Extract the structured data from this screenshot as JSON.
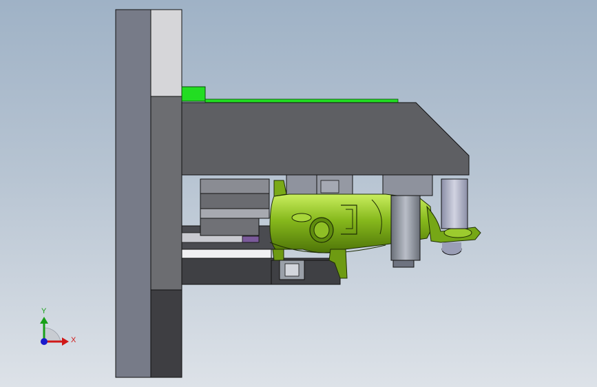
{
  "triad": {
    "y_label": "Y",
    "x_label": "X"
  },
  "colors": {
    "background_top": "#9fb2c6",
    "background_bottom": "#dde2e8",
    "plate_dark": "#5f6066",
    "plate_mid": "#75787e",
    "plate_light": "#d6d7da",
    "part_green": "#6e9b12",
    "part_green_light": "#b7e34a",
    "highlight_green": "#22dd22",
    "axis_x": "#d01818",
    "axis_y": "#18a018",
    "axis_z": "#1a1acc"
  }
}
